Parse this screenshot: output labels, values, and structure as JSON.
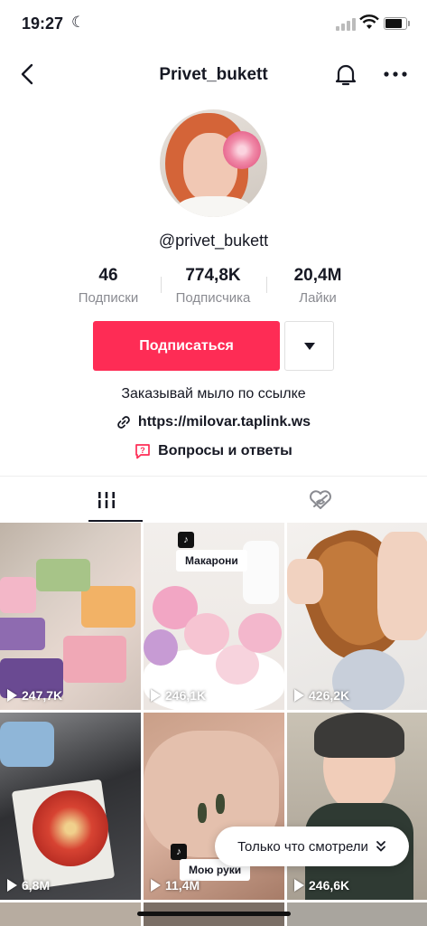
{
  "status_bar": {
    "time": "19:27"
  },
  "header": {
    "title": "Privet_bukett"
  },
  "profile": {
    "handle": "@privet_bukett",
    "stats": [
      {
        "value": "46",
        "label": "Подписки"
      },
      {
        "value": "774,8K",
        "label": "Подписчика"
      },
      {
        "value": "20,4M",
        "label": "Лайки"
      }
    ],
    "follow_label": "Подписаться",
    "bio": "Заказывай мыло по ссылке",
    "link": "https://milovar.taplink.ws",
    "qa_label": "Вопросы и ответы"
  },
  "videos": [
    {
      "views": "247,7K",
      "caption": ""
    },
    {
      "views": "246,1K",
      "caption": "Макарони"
    },
    {
      "views": "426,2K",
      "caption": ""
    },
    {
      "views": "6,8M",
      "caption": ""
    },
    {
      "views": "11,4M",
      "caption": "Мою руки"
    },
    {
      "views": "246,6K",
      "caption": ""
    }
  ],
  "recently_watched": {
    "label": "Только что смотрели"
  },
  "colors": {
    "accent": "#fe2c55",
    "text": "#161823",
    "muted": "#8a8b91"
  },
  "icons": [
    "back-icon",
    "bell-icon",
    "more-icon",
    "dropdown-icon",
    "link-icon",
    "qa-icon",
    "videos-tab-icon",
    "liked-tab-icon",
    "play-icon",
    "double-chevron-down-icon"
  ]
}
